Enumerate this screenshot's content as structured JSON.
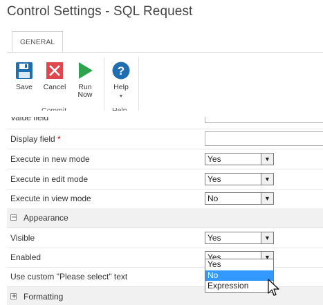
{
  "window": {
    "title": "Control Settings - SQL Request"
  },
  "ribbon": {
    "tab": "GENERAL",
    "buttons": {
      "save": "Save",
      "cancel": "Cancel",
      "run_now_1": "Run",
      "run_now_2": "Now",
      "help": "Help"
    },
    "groups": {
      "commit": "Commit",
      "help": "Help"
    }
  },
  "form": {
    "value_field": {
      "label": "Value field"
    },
    "display_field": {
      "label": "Display field",
      "required_mark": "*"
    },
    "execute_new": {
      "label": "Execute in new mode",
      "value": "Yes"
    },
    "execute_edit": {
      "label": "Execute in edit mode",
      "value": "Yes"
    },
    "execute_view": {
      "label": "Execute in view mode",
      "value": "No"
    },
    "appearance": {
      "label": "Appearance",
      "toggle": "−"
    },
    "visible": {
      "label": "Visible",
      "value": "Yes"
    },
    "enabled": {
      "label": "Enabled",
      "value": "Yes"
    },
    "custom_select_text": {
      "label": "Use custom \"Please select\" text"
    },
    "formatting": {
      "label": "Formatting",
      "toggle": "+"
    }
  },
  "dropdown": {
    "options": [
      "Yes",
      "No",
      "Expression"
    ],
    "selected": "No"
  },
  "icons": {
    "save": "floppy-disk-icon",
    "cancel": "red-x-icon",
    "run": "green-play-icon",
    "help": "question-circle-icon"
  },
  "colors": {
    "save": "#1f6fb0",
    "cancel": "#e0474c",
    "run": "#2ea44f",
    "help": "#1f6fb0",
    "selection": "#3399ff"
  }
}
